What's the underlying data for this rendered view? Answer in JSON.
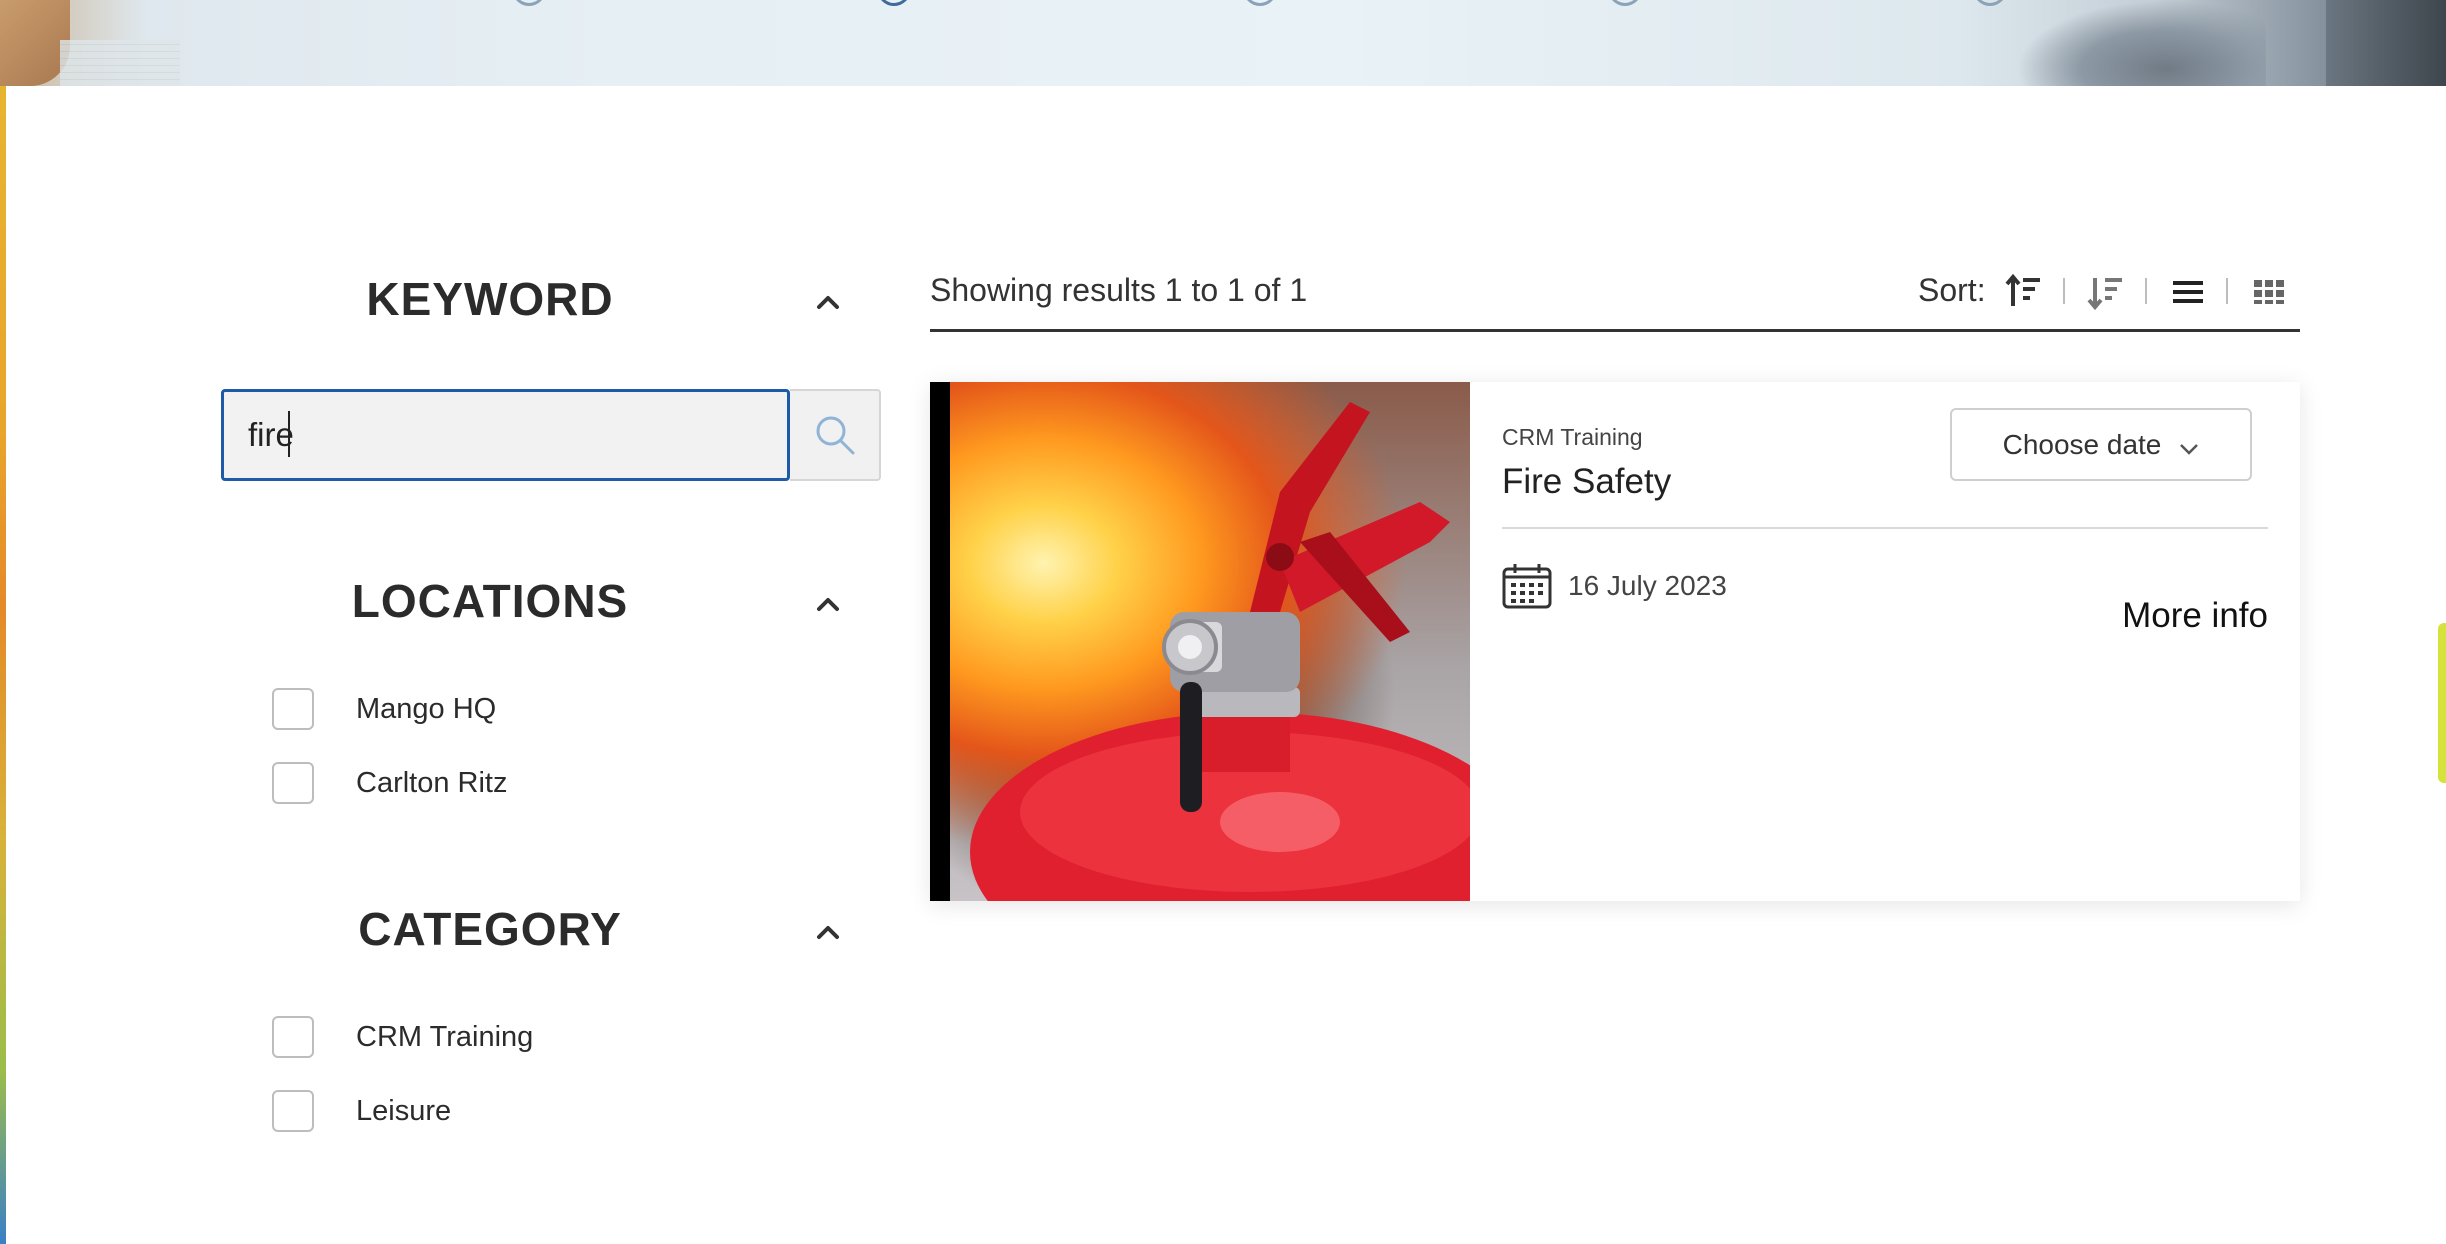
{
  "sidebar": {
    "keyword": {
      "heading": "KEYWORD",
      "value": "fire"
    },
    "locations": {
      "heading": "LOCATIONS",
      "items": [
        {
          "label": "Mango HQ"
        },
        {
          "label": "Carlton Ritz"
        }
      ]
    },
    "category": {
      "heading": "CATEGORY",
      "items": [
        {
          "label": "CRM Training"
        },
        {
          "label": "Leisure"
        }
      ]
    }
  },
  "results": {
    "summary": "Showing results 1 to 1 of 1",
    "sort_label": "Sort:",
    "sort_icons": [
      "sort-ascending-icon",
      "sort-descending-icon",
      "list-view-icon",
      "grid-view-icon"
    ]
  },
  "cards": [
    {
      "category": "CRM Training",
      "title": "Fire Safety",
      "choose_date": "Choose date",
      "date": "16 July 2023",
      "more_info": "More info"
    }
  ],
  "colors": {
    "accent": "#1e5aa8",
    "text": "#222222",
    "muted": "#444444"
  }
}
